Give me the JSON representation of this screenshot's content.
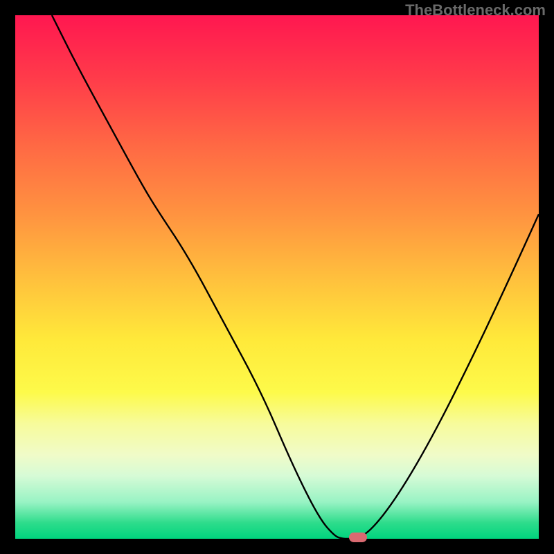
{
  "watermark": "TheBottleneck.com",
  "colors": {
    "background": "#000000",
    "curve": "#000000",
    "marker": "#d96a71",
    "gradient_stops": [
      "#ff1750",
      "#ff3b4a",
      "#ff6944",
      "#ff9340",
      "#ffbf3d",
      "#ffe93a",
      "#fdfa4a",
      "#f7fb9b",
      "#f0fbc8",
      "#d6fbd6",
      "#98f3c4",
      "#2ddc8b",
      "#00d47e"
    ]
  },
  "chart_data": {
    "type": "line",
    "title": "",
    "xlabel": "",
    "ylabel": "",
    "xlim": [
      0,
      100
    ],
    "ylim": [
      0,
      100
    ],
    "series": [
      {
        "name": "bottleneck-curve",
        "x": [
          7,
          12,
          18,
          24,
          27,
          33,
          40,
          47,
          53,
          58,
          61,
          62.5,
          64.5,
          67.5,
          73,
          80,
          88,
          95,
          100
        ],
        "y": [
          100,
          90,
          79,
          68,
          63,
          54,
          41,
          28,
          14,
          4,
          0.5,
          0,
          0,
          1,
          8,
          20,
          36,
          51,
          62
        ]
      }
    ],
    "marker": {
      "x": 65.5,
      "y": 0
    },
    "annotations": []
  }
}
